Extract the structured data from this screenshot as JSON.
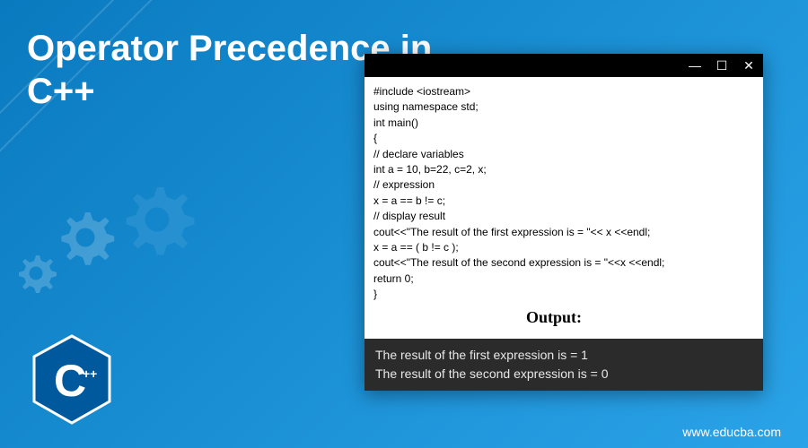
{
  "title_line1": "Operator Precedence in",
  "title_line2": "C++",
  "logo_text": "C",
  "logo_plus": "++",
  "code": {
    "l1": "#include <iostream>",
    "l2": "using namespace std;",
    "l3": "int main()",
    "l4": "{",
    "l5": "// declare variables",
    "l6": "int a = 10, b=22, c=2, x;",
    "l7": "// expression",
    "l8": "x = a == b != c;",
    "l9": "// display result",
    "l10": "cout<<\"The result of the first expression is = \"<< x <<endl;",
    "l11": "x = a == ( b != c );",
    "l12": "cout<<\"The result of the second expression is = \"<<x <<endl;",
    "l13": "return 0;",
    "l14": "}"
  },
  "output_label": "Output:",
  "output": {
    "l1": "The result of the first expression is = 1",
    "l2": "The result of the second expression is = 0"
  },
  "website": "www.educba.com",
  "win_min": "—",
  "win_max": "☐",
  "win_close": "✕"
}
